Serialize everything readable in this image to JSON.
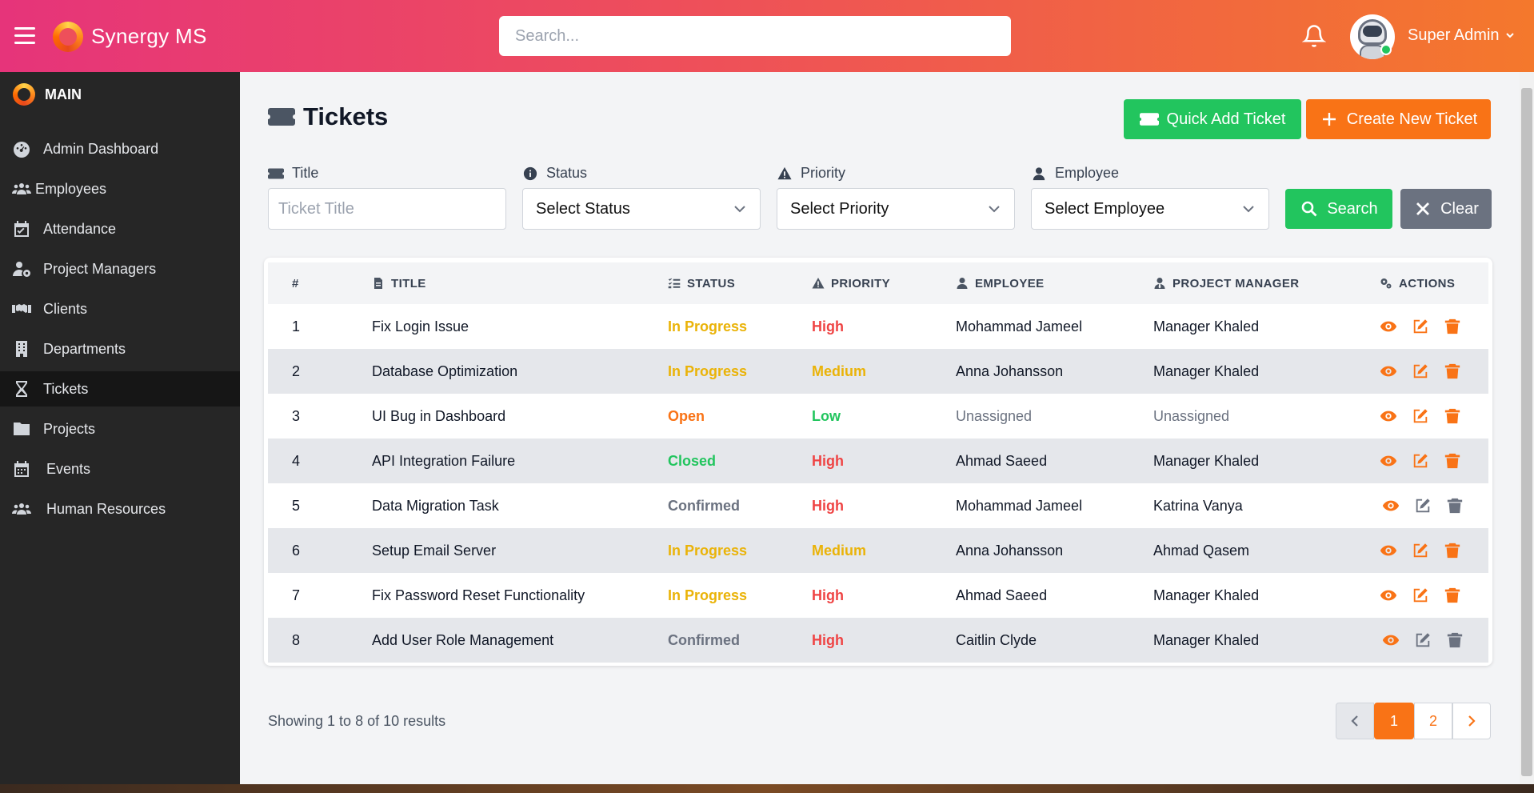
{
  "header": {
    "brand": "Synergy MS",
    "search_placeholder": "Search...",
    "user_name": "Super Admin"
  },
  "sidebar": {
    "section": "MAIN",
    "items": [
      {
        "label": "Admin Dashboard",
        "icon": "dashboard-icon"
      },
      {
        "label": "Employees",
        "icon": "users-icon"
      },
      {
        "label": "Attendance",
        "icon": "calendar-check-icon"
      },
      {
        "label": "Project Managers",
        "icon": "user-gear-icon"
      },
      {
        "label": "Clients",
        "icon": "handshake-icon"
      },
      {
        "label": "Departments",
        "icon": "building-icon"
      },
      {
        "label": "Tickets",
        "icon": "hourglass-icon",
        "active": true
      },
      {
        "label": "Projects",
        "icon": "folder-icon"
      },
      {
        "label": "Events",
        "icon": "calendar-icon"
      },
      {
        "label": "Human Resources",
        "icon": "people-group-icon"
      }
    ]
  },
  "page": {
    "title": "Tickets",
    "quick_add_label": "Quick Add Ticket",
    "create_label": "Create New Ticket"
  },
  "filters": {
    "title_label": "Title",
    "title_placeholder": "Ticket Title",
    "status_label": "Status",
    "status_value": "Select Status",
    "priority_label": "Priority",
    "priority_value": "Select Priority",
    "employee_label": "Employee",
    "employee_value": "Select Employee",
    "search_label": "Search",
    "clear_label": "Clear"
  },
  "table": {
    "headers": {
      "num": "#",
      "title": "TITLE",
      "status": "STATUS",
      "priority": "PRIORITY",
      "employee": "EMPLOYEE",
      "pm": "PROJECT MANAGER",
      "actions": "ACTIONS"
    },
    "rows": [
      {
        "num": "1",
        "title": "Fix Login Issue",
        "status": "In Progress",
        "priority": "High",
        "employee": "Mohammad Jameel",
        "pm": "Manager Khaled"
      },
      {
        "num": "2",
        "title": "Database Optimization",
        "status": "In Progress",
        "priority": "Medium",
        "employee": "Anna Johansson",
        "pm": "Manager Khaled"
      },
      {
        "num": "3",
        "title": "UI Bug in Dashboard",
        "status": "Open",
        "priority": "Low",
        "employee": "Unassigned",
        "pm": "Unassigned"
      },
      {
        "num": "4",
        "title": "API Integration Failure",
        "status": "Closed",
        "priority": "High",
        "employee": "Ahmad Saeed",
        "pm": "Manager Khaled"
      },
      {
        "num": "5",
        "title": "Data Migration Task",
        "status": "Confirmed",
        "priority": "High",
        "employee": "Mohammad Jameel",
        "pm": "Katrina Vanya"
      },
      {
        "num": "6",
        "title": "Setup Email Server",
        "status": "In Progress",
        "priority": "Medium",
        "employee": "Anna Johansson",
        "pm": "Ahmad Qasem"
      },
      {
        "num": "7",
        "title": "Fix Password Reset Functionality",
        "status": "In Progress",
        "priority": "High",
        "employee": "Ahmad Saeed",
        "pm": "Manager Khaled"
      },
      {
        "num": "8",
        "title": "Add User Role Management",
        "status": "Confirmed",
        "priority": "High",
        "employee": "Caitlin Clyde",
        "pm": "Manager Khaled"
      }
    ]
  },
  "pagination": {
    "summary": "Showing 1 to 8 of 10 results",
    "pages": [
      "1",
      "2"
    ],
    "current": "1"
  },
  "colors": {
    "accent": "#f97316",
    "success": "#22c55e",
    "header_start": "#e6347a",
    "header_end": "#f4782c",
    "sidebar": "#262626"
  }
}
